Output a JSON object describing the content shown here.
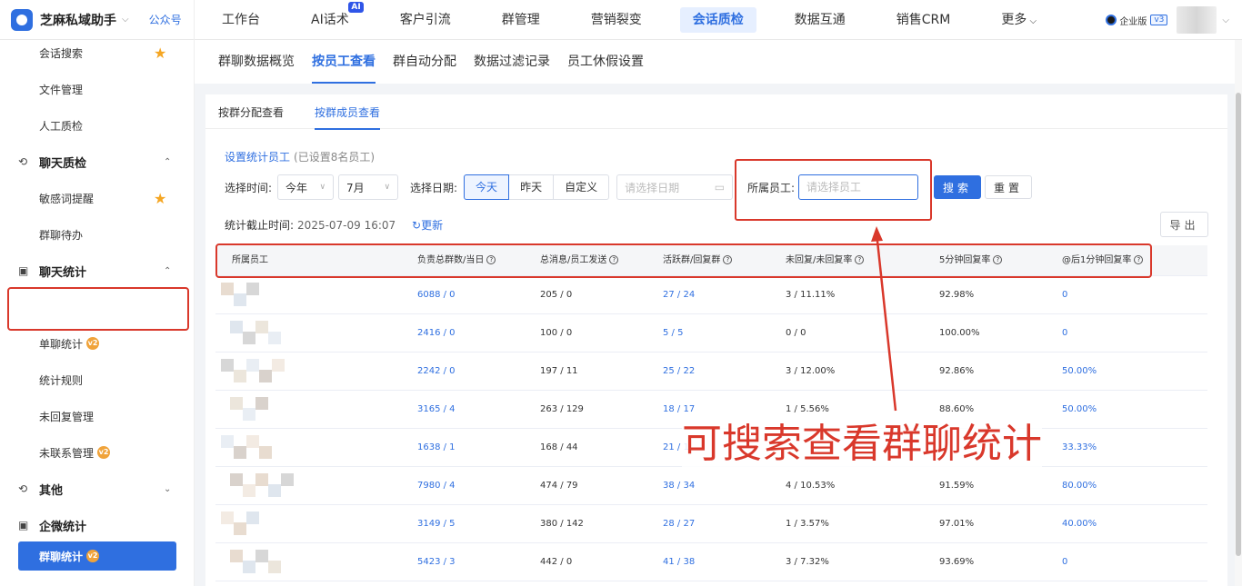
{
  "app": {
    "brand": "芝麻私域助手",
    "gzh": "公众号",
    "edition": "企业版",
    "version": "v3"
  },
  "topnav": [
    {
      "label": "工作台",
      "active": false
    },
    {
      "label": "AI话术",
      "badge": "AI",
      "active": false
    },
    {
      "label": "客户引流",
      "active": false
    },
    {
      "label": "群管理",
      "active": false
    },
    {
      "label": "营销裂变",
      "active": false
    },
    {
      "label": "会话质检",
      "active": true
    },
    {
      "label": "数据互通",
      "active": false
    },
    {
      "label": "销售CRM",
      "active": false
    },
    {
      "label": "更多",
      "caret": true,
      "active": false
    }
  ],
  "sidebar": {
    "items": [
      {
        "label": "会话搜索",
        "star": true
      },
      {
        "label": "文件管理"
      },
      {
        "label": "人工质检"
      },
      {
        "group": "聊天质检",
        "caret": "up"
      },
      {
        "label": "敏感词提醒",
        "star": true
      },
      {
        "label": "群聊待办"
      },
      {
        "group": "聊天统计",
        "caret": "up"
      },
      {
        "label": "群聊统计",
        "badge": "v2",
        "active": true
      },
      {
        "label": "单聊统计",
        "badge": "v2"
      },
      {
        "label": "统计规则"
      },
      {
        "label": "未回复管理"
      },
      {
        "label": "未联系管理",
        "badge": "v2"
      },
      {
        "group": "其他",
        "caret": "down"
      },
      {
        "group": "企微统计"
      }
    ]
  },
  "subtabs": [
    "群聊数据概览",
    "按员工查看",
    "群自动分配",
    "数据过滤记录",
    "员工休假设置"
  ],
  "subtab_active": 1,
  "inner_tabs": [
    "按群分配查看",
    "按群成员查看"
  ],
  "inner_tab_active": 1,
  "filters": {
    "set_link": "设置统计员工",
    "set_note": "(已设置8名员工)",
    "time_label": "选择时间:",
    "year_value": "今年",
    "month_value": "7月",
    "date_label": "选择日期:",
    "date_options": [
      "今天",
      "昨天",
      "自定义"
    ],
    "date_active": 0,
    "date_placeholder": "请选择日期",
    "employee_label": "所属员工:",
    "employee_placeholder": "请选择员工",
    "search_label": "搜索",
    "reset_label": "重置"
  },
  "stat": {
    "label": "统计截止时间:",
    "time": "2025-07-09 16:07",
    "refresh": "更新"
  },
  "export_label": "导出",
  "table": {
    "columns": [
      "所属员工",
      "负责总群数/当日",
      "总消息/员工发送",
      "活跃群/回复群",
      "未回复/未回复率",
      "5分钟回复率",
      "@后1分钟回复率"
    ],
    "help_icons": [
      false,
      true,
      true,
      true,
      true,
      true,
      true
    ],
    "rows": [
      [
        "6088 / 0",
        "205 / 0",
        "27 / 24",
        "3 / 11.11%",
        "92.98%",
        "0"
      ],
      [
        "2416 / 0",
        "100 / 0",
        "5 / 5",
        "0 / 0",
        "100.00%",
        "0"
      ],
      [
        "2242 / 0",
        "197 / 11",
        "25 / 22",
        "3 / 12.00%",
        "92.86%",
        "50.00%"
      ],
      [
        "3165 / 4",
        "263 / 129",
        "18 / 17",
        "1 / 5.56%",
        "88.60%",
        "50.00%"
      ],
      [
        "1638 / 1",
        "168 / 44",
        "21 / 1",
        "",
        "",
        "33.33%"
      ],
      [
        "7980 / 4",
        "474 / 79",
        "38 / 34",
        "4 / 10.53%",
        "91.59%",
        "80.00%"
      ],
      [
        "3149 / 5",
        "380 / 142",
        "28 / 27",
        "1 / 3.57%",
        "97.01%",
        "40.00%"
      ],
      [
        "5423 / 3",
        "442 / 0",
        "41 / 38",
        "3 / 7.32%",
        "93.69%",
        "0"
      ]
    ],
    "link_cols": [
      0,
      2,
      5
    ]
  },
  "annotation": {
    "text": "可搜索查看群聊统计",
    "color": "#d9382b"
  },
  "colors": {
    "accent": "#2f6fe0",
    "highlight": "#d9382b",
    "star": "#f5a623",
    "badge": "#f0a33a"
  }
}
